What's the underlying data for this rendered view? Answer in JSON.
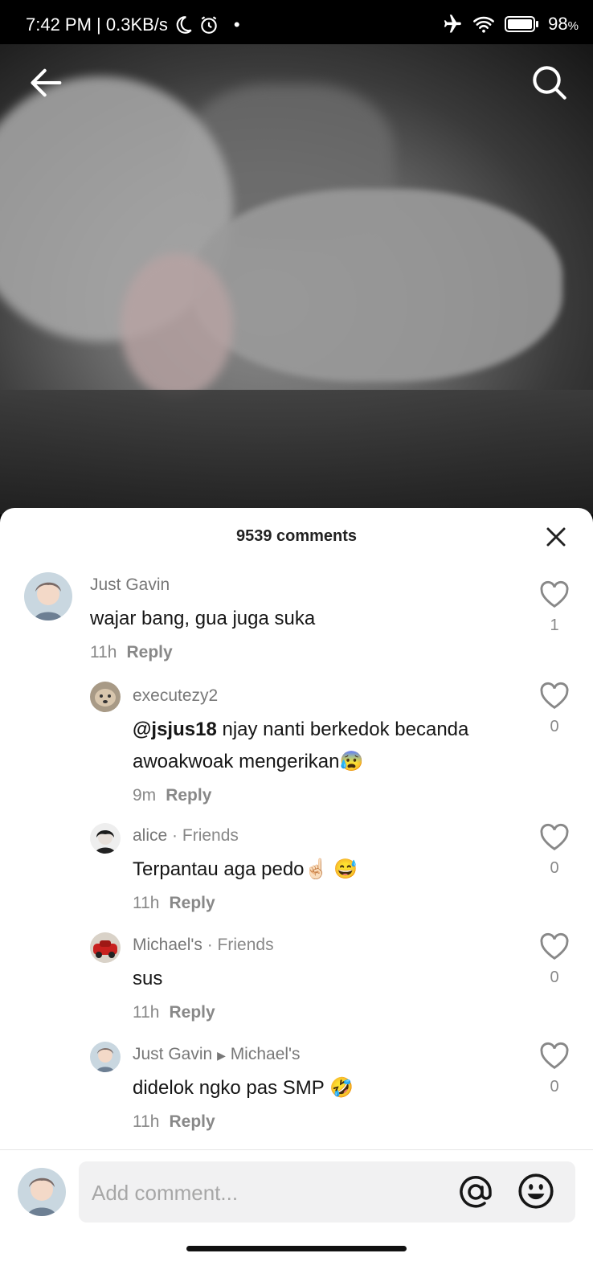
{
  "status_bar": {
    "time": "7:42 PM | 0.3KB/s",
    "battery": "98",
    "battery_unit": "%"
  },
  "comments_sheet": {
    "title": "9539 comments",
    "input_placeholder": "Add comment..."
  },
  "comments": [
    {
      "user": "Just Gavin",
      "text": "wajar bang, gua juga suka",
      "time": "11h",
      "reply": "Reply",
      "likes": "1",
      "avatar": "anime-boy"
    },
    {
      "user": "executezy2",
      "mention": "@jsjus18",
      "text": " njay nanti berkedok becanda awoakwoak mengerikan😰",
      "time": "9m",
      "reply": "Reply",
      "likes": "0",
      "avatar": "dog"
    },
    {
      "user": "alice",
      "tag": "· Friends",
      "text": "Terpantau aga pedo☝🏻 😅",
      "time": "11h",
      "reply": "Reply",
      "likes": "0",
      "avatar": "dark-hair"
    },
    {
      "user": "Michael's",
      "tag": "· Friends",
      "text": "sus",
      "time": "11h",
      "reply": "Reply",
      "likes": "0",
      "avatar": "car"
    },
    {
      "user": "Just Gavin",
      "reply_to": "Michael's",
      "text": "didelok ngko pas SMP 🤣",
      "time": "11h",
      "reply": "Reply",
      "likes": "0",
      "avatar": "anime-boy"
    }
  ],
  "icons": {
    "back": "back-arrow-icon",
    "search": "search-icon",
    "close": "close-icon",
    "like": "heart-outline-icon",
    "mention": "at-sign-icon",
    "emoji": "smiley-icon"
  }
}
